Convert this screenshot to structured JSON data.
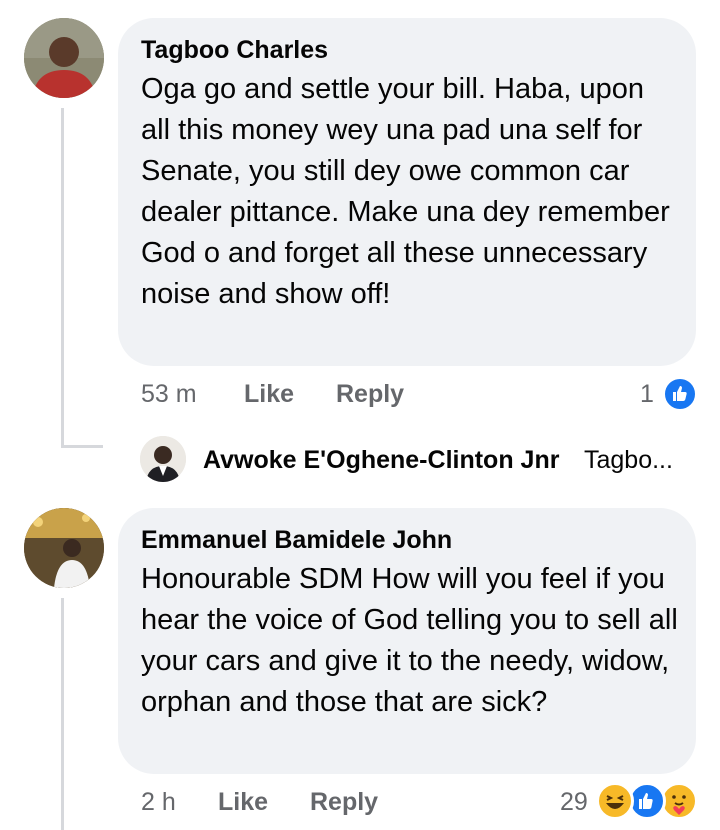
{
  "comments": [
    {
      "author": "Tagboo Charles",
      "text": "Oga go and settle your bill. Haba, upon all this money wey una pad una self for Senate, you still dey owe common car dealer pittance. Make una dey remember God o and forget all these unnecessary noise and show off!",
      "time": "53 m",
      "like_label": "Like",
      "reply_label": "Reply",
      "reaction_count": "1",
      "reactions": [
        "like-reaction-icon"
      ]
    },
    {
      "author": "Emmanuel Bamidele John",
      "text": "Honourable SDM How will you feel if you hear the voice of God telling you to sell all your cars and give it to  the needy, widow, orphan and those that are sick?",
      "time": "2 h",
      "like_label": "Like",
      "reply_label": "Reply",
      "reaction_count": "29",
      "reactions": [
        "haha-reaction-icon",
        "like-reaction-icon",
        "care-reaction-icon"
      ]
    }
  ],
  "reply_preview": {
    "author": "Avwoke E'Oghene-Clinton Jnr",
    "snippet": "Tagbo..."
  },
  "colors": {
    "bubble": "#f0f2f5",
    "meta_text": "#65676b",
    "like_blue": "#1877f2",
    "thread_line": "#d6d8dc"
  }
}
